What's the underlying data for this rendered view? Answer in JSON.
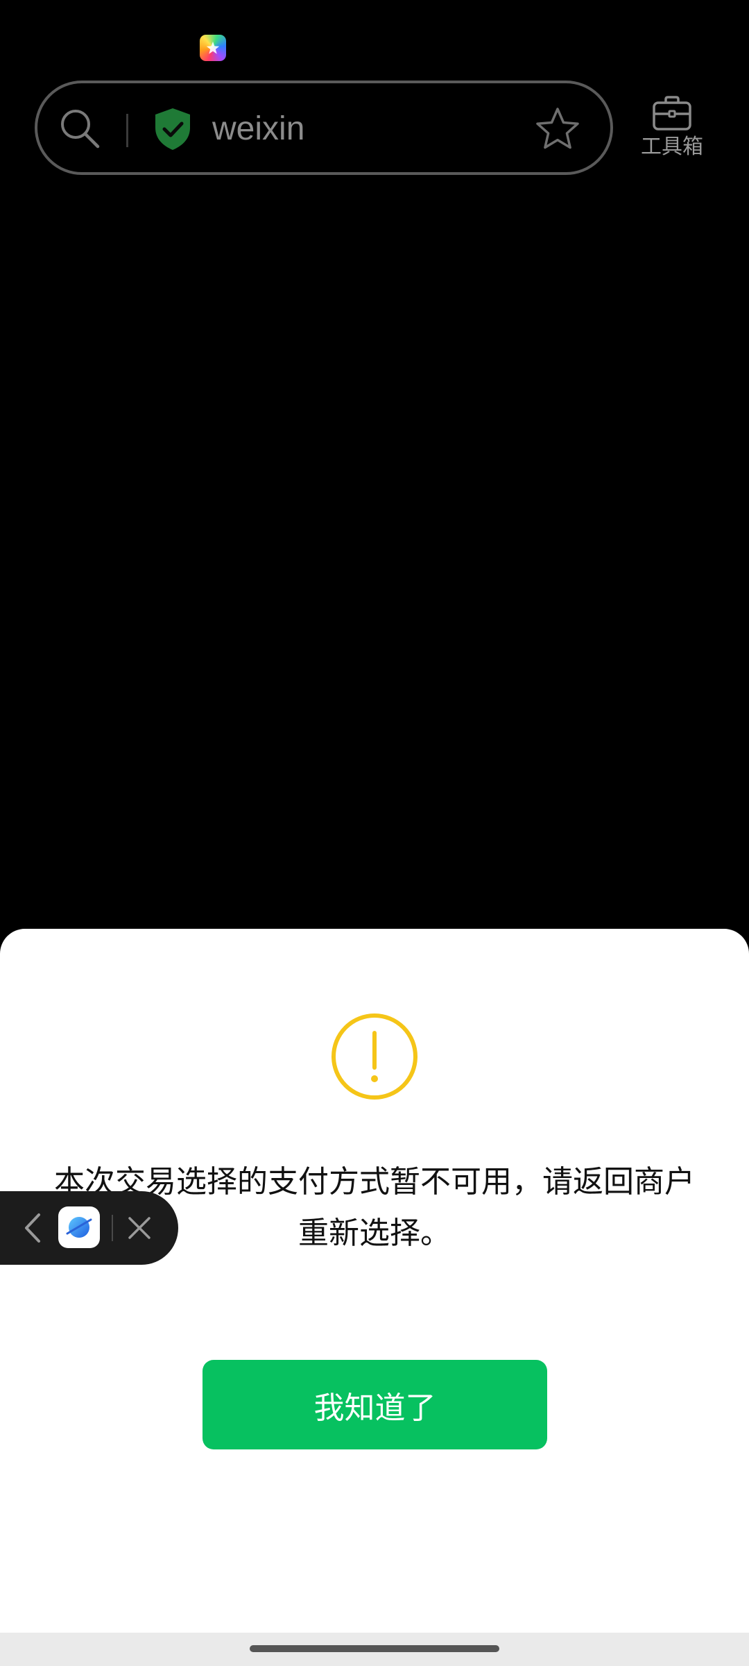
{
  "browser": {
    "url": "weixin",
    "toolbox_label": "工具箱"
  },
  "dialog": {
    "message": "本次交易选择的支付方式暂不可用，请返回商户重新选择。",
    "confirm_label": "我知道了"
  },
  "colors": {
    "accent_green": "#07c160",
    "warning_yellow": "#f5c518",
    "secure_green": "#1f7a36"
  },
  "icons": {
    "status": "app-logo-icon",
    "search": "search-icon",
    "secure": "shield-check-icon",
    "favorite": "star-icon",
    "toolbox": "toolbox-icon",
    "warning": "warning-icon",
    "back": "chevron-left-icon",
    "mini_app": "browser-app-icon",
    "close": "close-icon"
  }
}
